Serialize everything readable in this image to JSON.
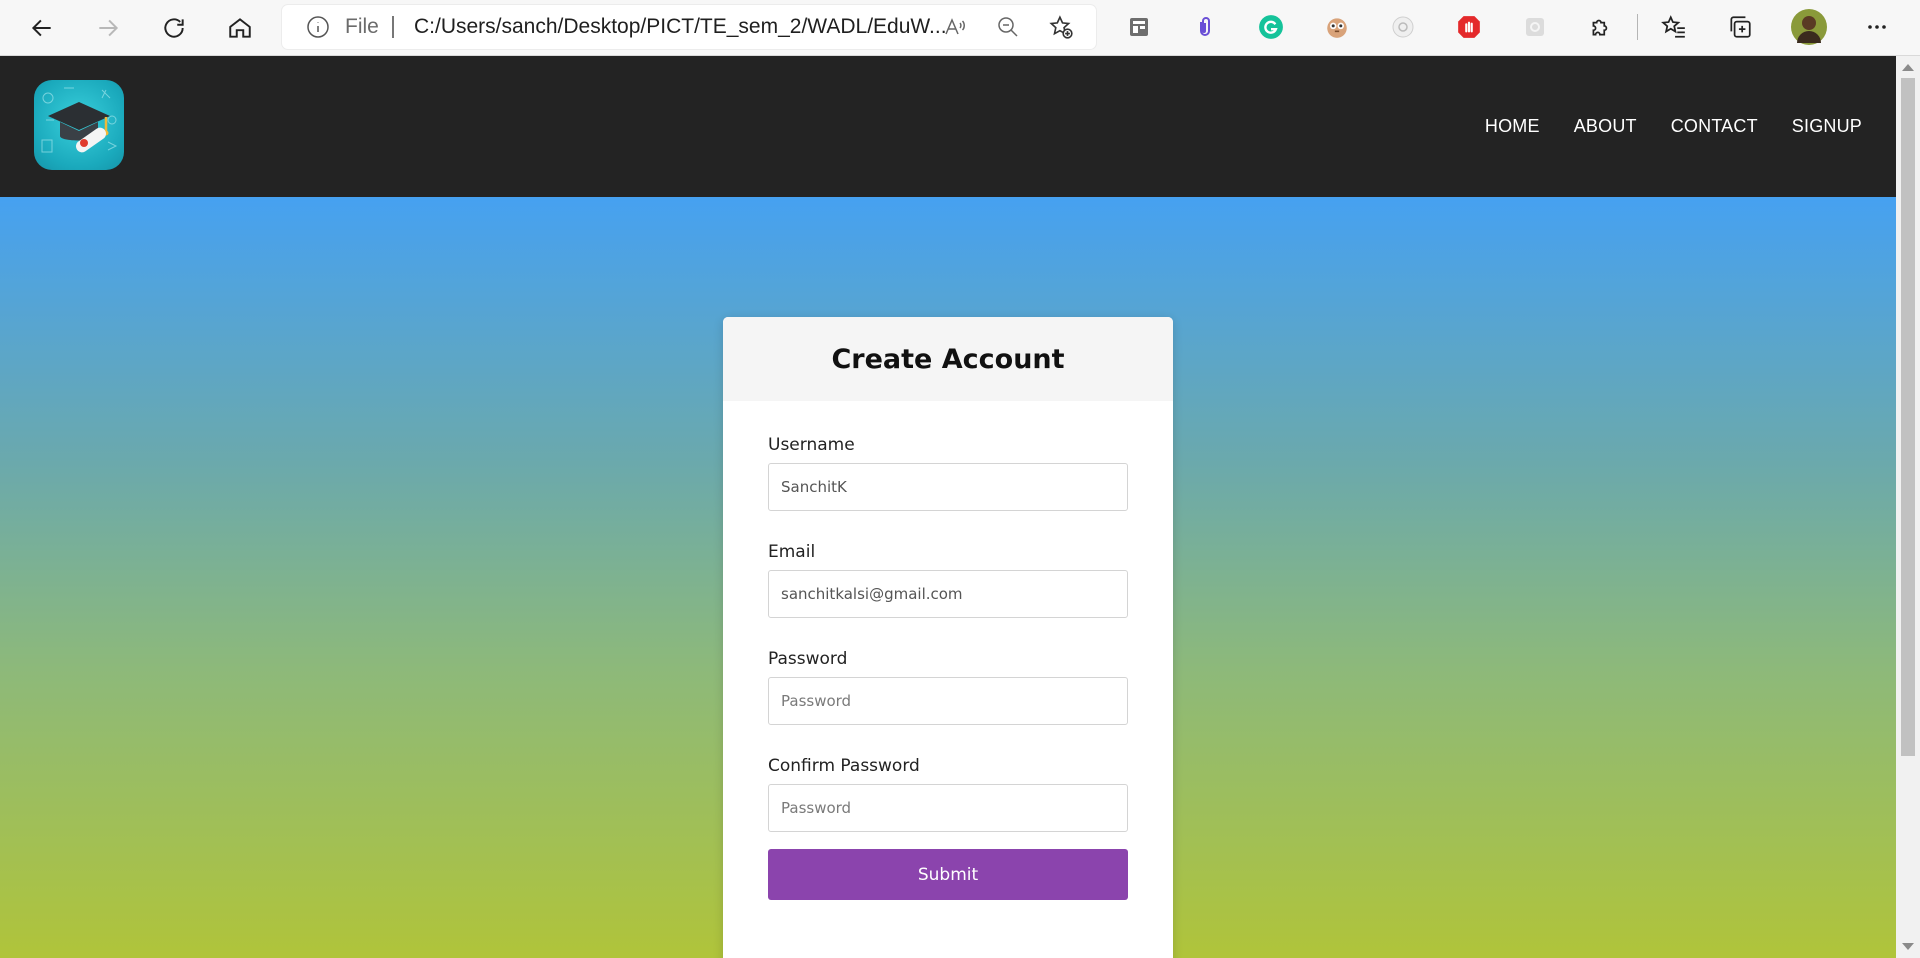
{
  "browser": {
    "file_label": "File",
    "url": "C:/Users/sanch/Desktop/PICT/TE_sem_2/WADL/EduW..."
  },
  "navbar": {
    "links": [
      "HOME",
      "ABOUT",
      "CONTACT",
      "SIGNUP"
    ]
  },
  "form": {
    "title": "Create Account",
    "username": {
      "label": "Username",
      "value": "SanchitK"
    },
    "email": {
      "label": "Email",
      "value": "sanchitkalsi@gmail.com"
    },
    "password": {
      "label": "Password",
      "placeholder": "Password"
    },
    "confirm_password": {
      "label": "Confirm Password",
      "placeholder": "Password"
    },
    "submit_label": "Submit"
  },
  "colors": {
    "navbar_bg": "#232323",
    "submit_bg": "#8b44ad",
    "gradient_top": "#46a1f1",
    "gradient_bottom": "#b0c43a"
  }
}
